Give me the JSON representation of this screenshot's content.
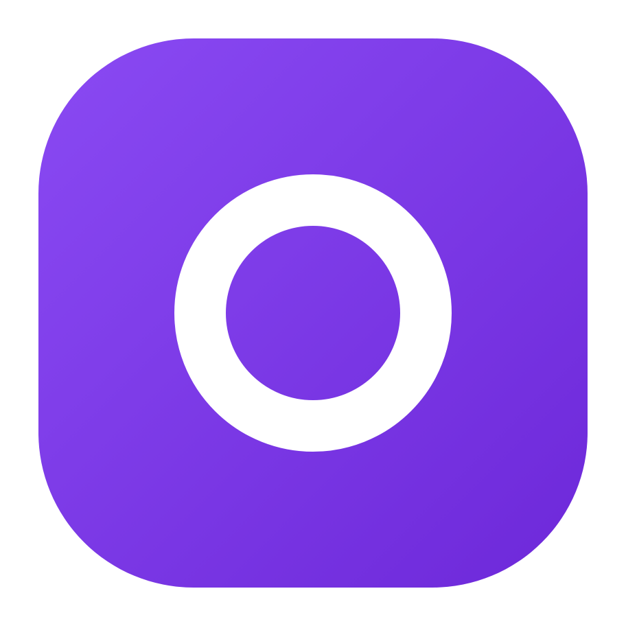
{
  "icon": {
    "name": "ring-icon",
    "background_gradient": {
      "start": "#8A4AF3",
      "end": "#6D28D9"
    },
    "ring_color": "#FFFFFF"
  }
}
